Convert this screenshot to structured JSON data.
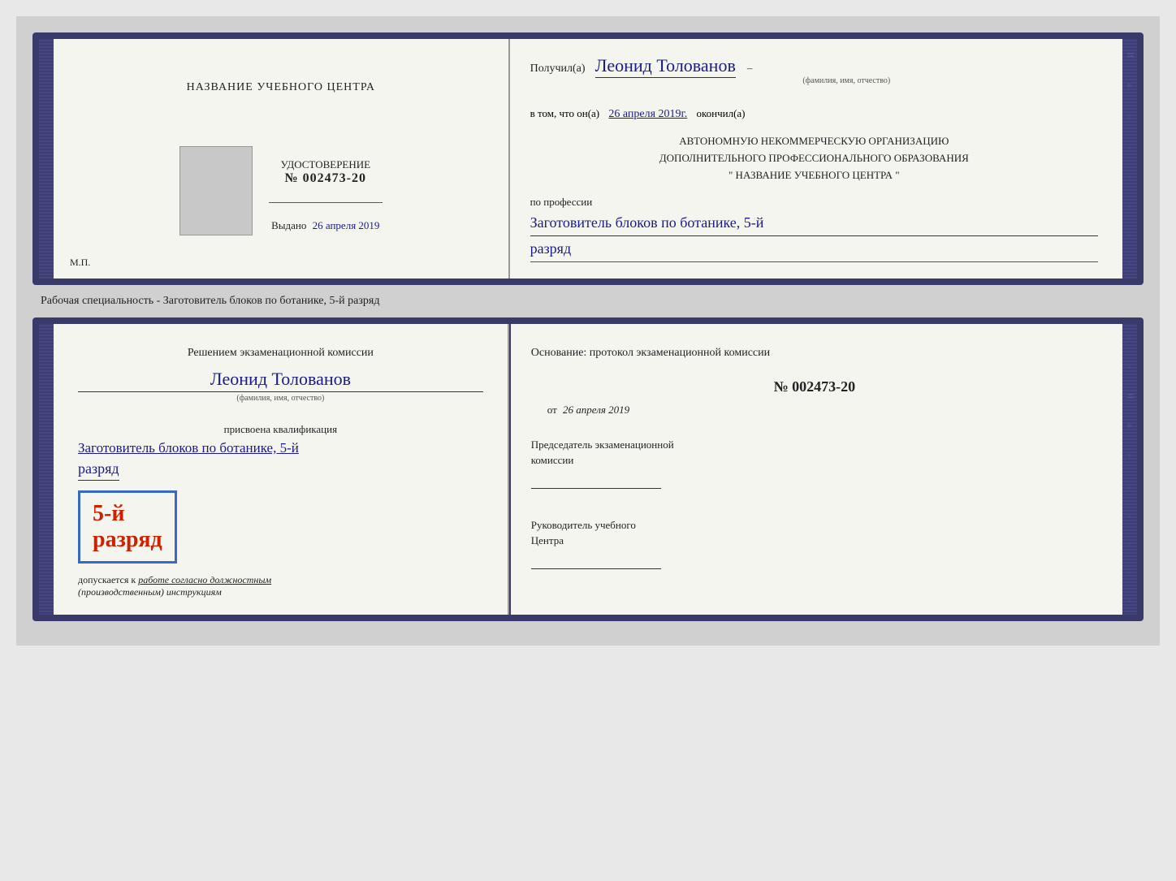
{
  "page": {
    "background": "#d0d0d0"
  },
  "top_doc": {
    "left": {
      "training_center_label": "НАЗВАНИЕ УЧЕБНОГО ЦЕНТРА",
      "certificate_label": "УДОСТОВЕРЕНИЕ",
      "number_prefix": "№",
      "number": "002473-20",
      "issued_label": "Выдано",
      "issued_date": "26 апреля 2019",
      "mp_label": "М.П."
    },
    "right": {
      "received_prefix": "Получил(а)",
      "person_name": "Леонид Толованов",
      "name_hint": "(фамилия, имя, отчество)",
      "confirm_prefix": "в том, что он(а)",
      "confirm_date": "26 апреля 2019г.",
      "confirm_suffix": "окончил(а)",
      "org_line1": "АВТОНОМНУЮ НЕКОММЕРЧЕСКУЮ ОРГАНИЗАЦИЮ",
      "org_line2": "ДОПОЛНИТЕЛЬНОГО ПРОФЕССИОНАЛЬНОГО ОБРАЗОВАНИЯ",
      "org_line3": "\"   НАЗВАНИЕ УЧЕБНОГО ЦЕНТРА   \"",
      "profession_label": "по профессии",
      "profession_value": "Заготовитель блоков по ботанике, 5-й",
      "rank_value": "разряд"
    }
  },
  "specialty_text": "Рабочая специальность - Заготовитель блоков по ботанике, 5-й разряд",
  "bottom_doc": {
    "left": {
      "decision_line1": "Решением экзаменационной комиссии",
      "person_name": "Леонид Толованов",
      "name_hint": "(фамилия, имя, отчество)",
      "assigned_label": "присвоена квалификация",
      "qualification_value": "Заготовитель блоков по ботанике, 5-й",
      "rank_value": "разряд",
      "badge_number": "5-й",
      "badge_rank": "разряд",
      "admitted_prefix": "допускается к",
      "admitted_italic": "работе согласно должностным",
      "admitted_italic2": "(производственным) инструкциям"
    },
    "right": {
      "basis_label": "Основание: протокол экзаменационной комиссии",
      "protocol_number": "№  002473-20",
      "protocol_date_prefix": "от",
      "protocol_date": "26 апреля 2019",
      "chairman_title1": "Председатель экзаменационной",
      "chairman_title2": "комиссии",
      "director_title1": "Руководитель учебного",
      "director_title2": "Центра"
    }
  },
  "edge_letters": [
    "И",
    "а",
    "←"
  ]
}
